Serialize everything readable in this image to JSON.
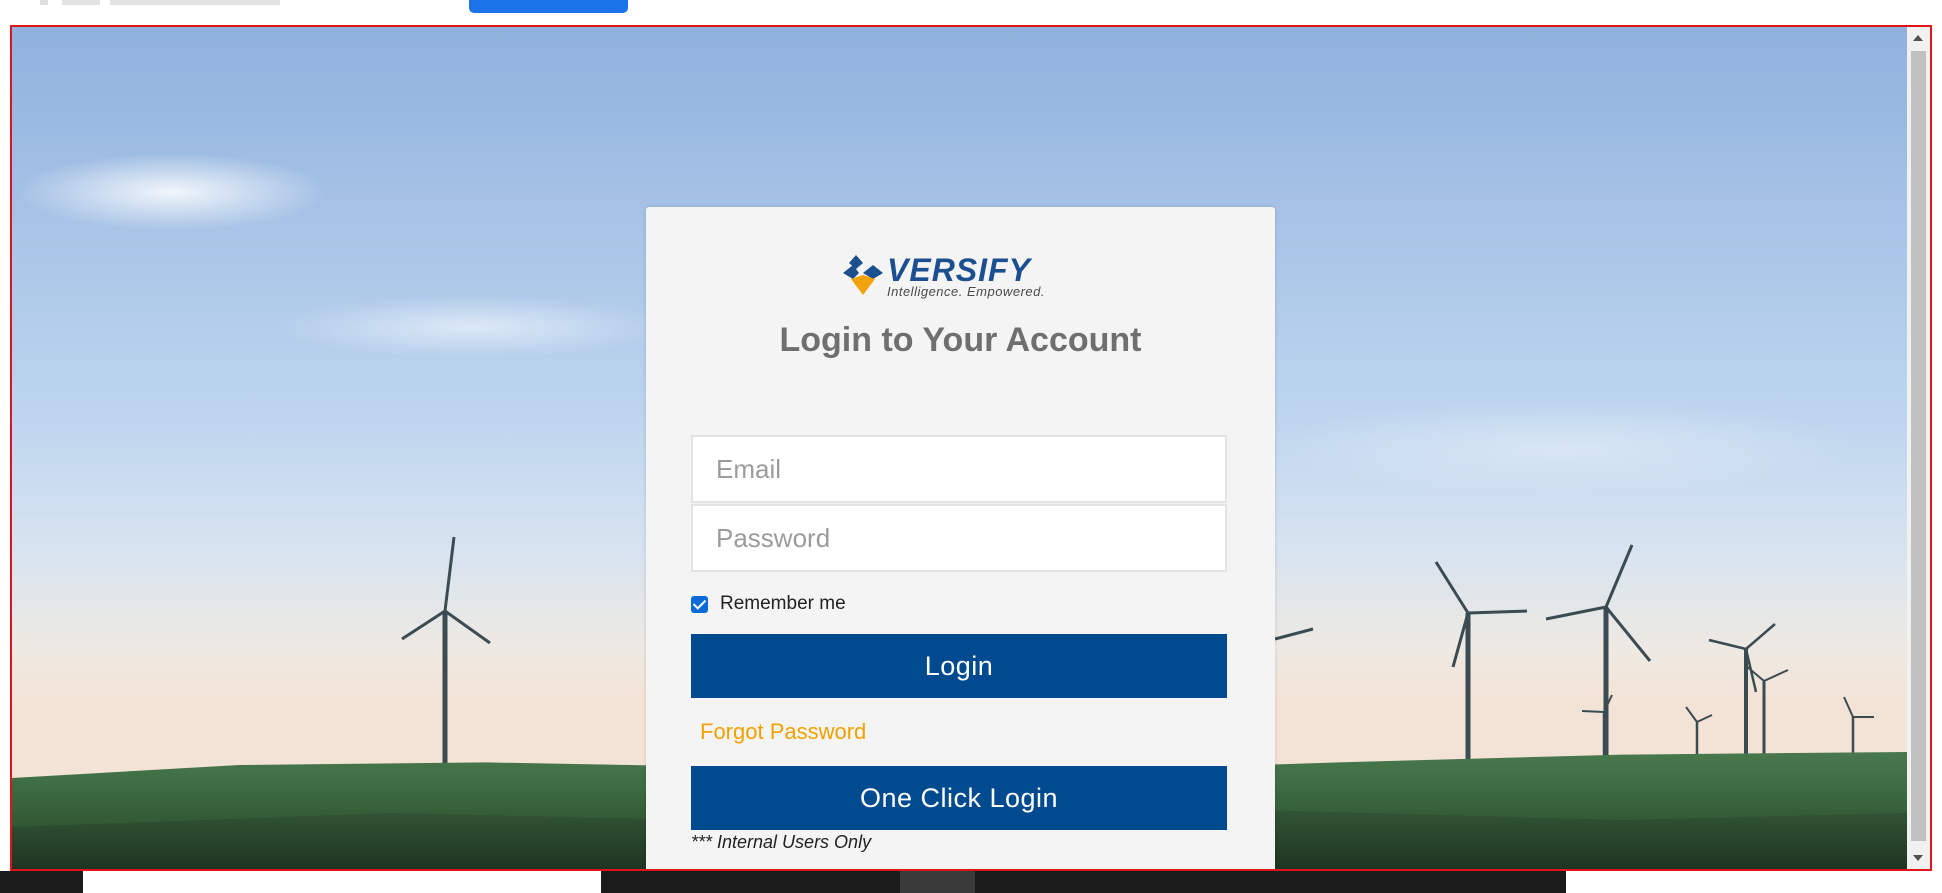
{
  "logo": {
    "brand": "VERSIFY",
    "tagline": "Intelligence. Empowered.",
    "colors": {
      "brand_blue": "#1c4f8f",
      "brand_orange": "#f2a20c"
    }
  },
  "login_card": {
    "title": "Login to Your Account",
    "email_placeholder": "Email",
    "password_placeholder": "Password",
    "remember_label": "Remember me",
    "remember_checked": true,
    "login_label": "Login",
    "forgot_label": "Forgot Password",
    "one_click_label": "One Click Login",
    "internal_note": "*** Internal Users Only"
  },
  "colors": {
    "button": "#004b8f",
    "link": "#f0a100",
    "frame_border": "#e0141b",
    "browser_button": "#1a73e8"
  }
}
